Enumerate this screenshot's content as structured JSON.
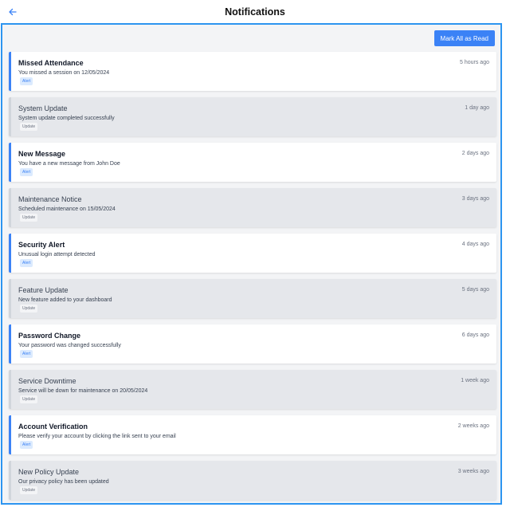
{
  "header": {
    "title": "Notifications",
    "back_icon": "arrow-left-icon",
    "accent_color": "#3b82f6"
  },
  "toolbar": {
    "mark_all_label": "Mark All as Read"
  },
  "notifications": [
    {
      "title": "Missed Attendance",
      "message": "You missed a session on 12/05/2024",
      "badge": "Alert",
      "time": "5 hours ago",
      "state": "unread"
    },
    {
      "title": "System Update",
      "message": "System update completed successfully",
      "badge": "Update",
      "time": "1 day ago",
      "state": "read"
    },
    {
      "title": "New Message",
      "message": "You have a new message from John Doe",
      "badge": "Alert",
      "time": "2 days ago",
      "state": "unread"
    },
    {
      "title": "Maintenance Notice",
      "message": "Scheduled maintenance on 15/05/2024",
      "badge": "Update",
      "time": "3 days ago",
      "state": "read"
    },
    {
      "title": "Security Alert",
      "message": "Unusual login attempt detected",
      "badge": "Alert",
      "time": "4 days ago",
      "state": "unread"
    },
    {
      "title": "Feature Update",
      "message": "New feature added to your dashboard",
      "badge": "Update",
      "time": "5 days ago",
      "state": "read"
    },
    {
      "title": "Password Change",
      "message": "Your password was changed successfully",
      "badge": "Alert",
      "time": "6 days ago",
      "state": "unread"
    },
    {
      "title": "Service Downtime",
      "message": "Service will be down for maintenance on 20/05/2024",
      "badge": "Update",
      "time": "1 week ago",
      "state": "read"
    },
    {
      "title": "Account Verification",
      "message": "Please verify your account by clicking the link sent to your email",
      "badge": "Alert",
      "time": "2 weeks ago",
      "state": "unread"
    },
    {
      "title": "New Policy Update",
      "message": "Our privacy policy has been updated",
      "badge": "Update",
      "time": "3 weeks ago",
      "state": "read"
    }
  ]
}
